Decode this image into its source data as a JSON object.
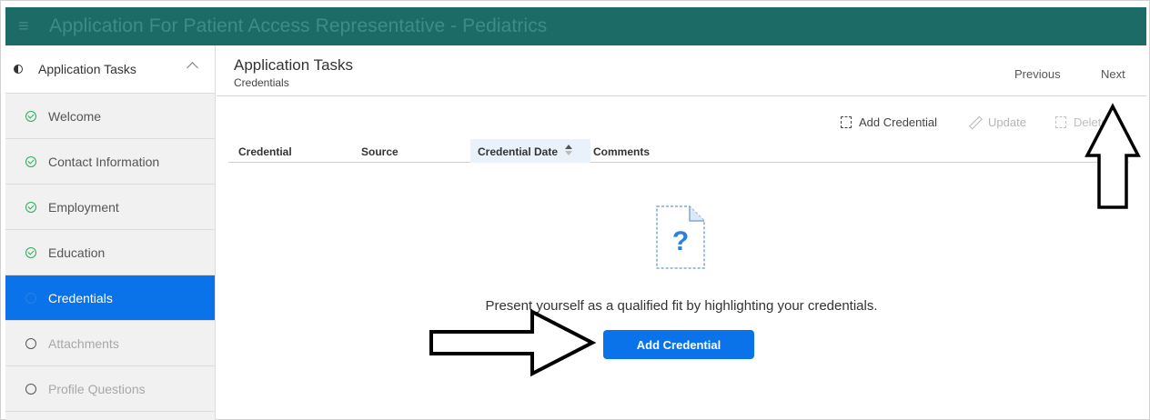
{
  "header": {
    "title": "Application For Patient Access Representative - Pediatrics",
    "menu_icon": "hamburger-menu-icon",
    "background": "#1d6b66"
  },
  "sidebar": {
    "section_label": "Application Tasks",
    "items": [
      {
        "label": "Welcome",
        "status": "complete"
      },
      {
        "label": "Contact Information",
        "status": "complete"
      },
      {
        "label": "Employment",
        "status": "complete"
      },
      {
        "label": "Education",
        "status": "complete"
      },
      {
        "label": "Credentials",
        "status": "current"
      },
      {
        "label": "Attachments",
        "status": "incomplete"
      },
      {
        "label": "Profile Questions",
        "status": "incomplete"
      }
    ]
  },
  "main": {
    "title": "Application Tasks",
    "subtitle": "Credentials",
    "nav": {
      "previous": "Previous",
      "next": "Next"
    },
    "toolbar": {
      "add": "Add Credential",
      "update": "Update",
      "delete": "Delete"
    },
    "table": {
      "columns": [
        "Credential",
        "Source",
        "Credential Date",
        "Comments"
      ]
    },
    "empty_state": {
      "icon": "question-document-icon",
      "message": "Present yourself as a qualified fit by highlighting your credentials.",
      "button": "Add Credential"
    }
  },
  "colors": {
    "accent": "#0a73ea",
    "complete": "#2fa85a"
  }
}
